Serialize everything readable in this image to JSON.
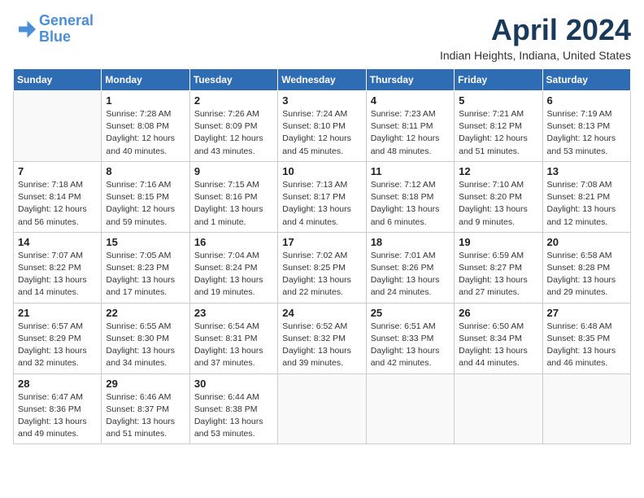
{
  "header": {
    "logo_line1": "General",
    "logo_line2": "Blue",
    "month_title": "April 2024",
    "location": "Indian Heights, Indiana, United States"
  },
  "weekdays": [
    "Sunday",
    "Monday",
    "Tuesday",
    "Wednesday",
    "Thursday",
    "Friday",
    "Saturday"
  ],
  "weeks": [
    [
      {
        "num": "",
        "sunrise": "",
        "sunset": "",
        "daylight": ""
      },
      {
        "num": "1",
        "sunrise": "Sunrise: 7:28 AM",
        "sunset": "Sunset: 8:08 PM",
        "daylight": "Daylight: 12 hours and 40 minutes."
      },
      {
        "num": "2",
        "sunrise": "Sunrise: 7:26 AM",
        "sunset": "Sunset: 8:09 PM",
        "daylight": "Daylight: 12 hours and 43 minutes."
      },
      {
        "num": "3",
        "sunrise": "Sunrise: 7:24 AM",
        "sunset": "Sunset: 8:10 PM",
        "daylight": "Daylight: 12 hours and 45 minutes."
      },
      {
        "num": "4",
        "sunrise": "Sunrise: 7:23 AM",
        "sunset": "Sunset: 8:11 PM",
        "daylight": "Daylight: 12 hours and 48 minutes."
      },
      {
        "num": "5",
        "sunrise": "Sunrise: 7:21 AM",
        "sunset": "Sunset: 8:12 PM",
        "daylight": "Daylight: 12 hours and 51 minutes."
      },
      {
        "num": "6",
        "sunrise": "Sunrise: 7:19 AM",
        "sunset": "Sunset: 8:13 PM",
        "daylight": "Daylight: 12 hours and 53 minutes."
      }
    ],
    [
      {
        "num": "7",
        "sunrise": "Sunrise: 7:18 AM",
        "sunset": "Sunset: 8:14 PM",
        "daylight": "Daylight: 12 hours and 56 minutes."
      },
      {
        "num": "8",
        "sunrise": "Sunrise: 7:16 AM",
        "sunset": "Sunset: 8:15 PM",
        "daylight": "Daylight: 12 hours and 59 minutes."
      },
      {
        "num": "9",
        "sunrise": "Sunrise: 7:15 AM",
        "sunset": "Sunset: 8:16 PM",
        "daylight": "Daylight: 13 hours and 1 minute."
      },
      {
        "num": "10",
        "sunrise": "Sunrise: 7:13 AM",
        "sunset": "Sunset: 8:17 PM",
        "daylight": "Daylight: 13 hours and 4 minutes."
      },
      {
        "num": "11",
        "sunrise": "Sunrise: 7:12 AM",
        "sunset": "Sunset: 8:18 PM",
        "daylight": "Daylight: 13 hours and 6 minutes."
      },
      {
        "num": "12",
        "sunrise": "Sunrise: 7:10 AM",
        "sunset": "Sunset: 8:20 PM",
        "daylight": "Daylight: 13 hours and 9 minutes."
      },
      {
        "num": "13",
        "sunrise": "Sunrise: 7:08 AM",
        "sunset": "Sunset: 8:21 PM",
        "daylight": "Daylight: 13 hours and 12 minutes."
      }
    ],
    [
      {
        "num": "14",
        "sunrise": "Sunrise: 7:07 AM",
        "sunset": "Sunset: 8:22 PM",
        "daylight": "Daylight: 13 hours and 14 minutes."
      },
      {
        "num": "15",
        "sunrise": "Sunrise: 7:05 AM",
        "sunset": "Sunset: 8:23 PM",
        "daylight": "Daylight: 13 hours and 17 minutes."
      },
      {
        "num": "16",
        "sunrise": "Sunrise: 7:04 AM",
        "sunset": "Sunset: 8:24 PM",
        "daylight": "Daylight: 13 hours and 19 minutes."
      },
      {
        "num": "17",
        "sunrise": "Sunrise: 7:02 AM",
        "sunset": "Sunset: 8:25 PM",
        "daylight": "Daylight: 13 hours and 22 minutes."
      },
      {
        "num": "18",
        "sunrise": "Sunrise: 7:01 AM",
        "sunset": "Sunset: 8:26 PM",
        "daylight": "Daylight: 13 hours and 24 minutes."
      },
      {
        "num": "19",
        "sunrise": "Sunrise: 6:59 AM",
        "sunset": "Sunset: 8:27 PM",
        "daylight": "Daylight: 13 hours and 27 minutes."
      },
      {
        "num": "20",
        "sunrise": "Sunrise: 6:58 AM",
        "sunset": "Sunset: 8:28 PM",
        "daylight": "Daylight: 13 hours and 29 minutes."
      }
    ],
    [
      {
        "num": "21",
        "sunrise": "Sunrise: 6:57 AM",
        "sunset": "Sunset: 8:29 PM",
        "daylight": "Daylight: 13 hours and 32 minutes."
      },
      {
        "num": "22",
        "sunrise": "Sunrise: 6:55 AM",
        "sunset": "Sunset: 8:30 PM",
        "daylight": "Daylight: 13 hours and 34 minutes."
      },
      {
        "num": "23",
        "sunrise": "Sunrise: 6:54 AM",
        "sunset": "Sunset: 8:31 PM",
        "daylight": "Daylight: 13 hours and 37 minutes."
      },
      {
        "num": "24",
        "sunrise": "Sunrise: 6:52 AM",
        "sunset": "Sunset: 8:32 PM",
        "daylight": "Daylight: 13 hours and 39 minutes."
      },
      {
        "num": "25",
        "sunrise": "Sunrise: 6:51 AM",
        "sunset": "Sunset: 8:33 PM",
        "daylight": "Daylight: 13 hours and 42 minutes."
      },
      {
        "num": "26",
        "sunrise": "Sunrise: 6:50 AM",
        "sunset": "Sunset: 8:34 PM",
        "daylight": "Daylight: 13 hours and 44 minutes."
      },
      {
        "num": "27",
        "sunrise": "Sunrise: 6:48 AM",
        "sunset": "Sunset: 8:35 PM",
        "daylight": "Daylight: 13 hours and 46 minutes."
      }
    ],
    [
      {
        "num": "28",
        "sunrise": "Sunrise: 6:47 AM",
        "sunset": "Sunset: 8:36 PM",
        "daylight": "Daylight: 13 hours and 49 minutes."
      },
      {
        "num": "29",
        "sunrise": "Sunrise: 6:46 AM",
        "sunset": "Sunset: 8:37 PM",
        "daylight": "Daylight: 13 hours and 51 minutes."
      },
      {
        "num": "30",
        "sunrise": "Sunrise: 6:44 AM",
        "sunset": "Sunset: 8:38 PM",
        "daylight": "Daylight: 13 hours and 53 minutes."
      },
      {
        "num": "",
        "sunrise": "",
        "sunset": "",
        "daylight": ""
      },
      {
        "num": "",
        "sunrise": "",
        "sunset": "",
        "daylight": ""
      },
      {
        "num": "",
        "sunrise": "",
        "sunset": "",
        "daylight": ""
      },
      {
        "num": "",
        "sunrise": "",
        "sunset": "",
        "daylight": ""
      }
    ]
  ]
}
